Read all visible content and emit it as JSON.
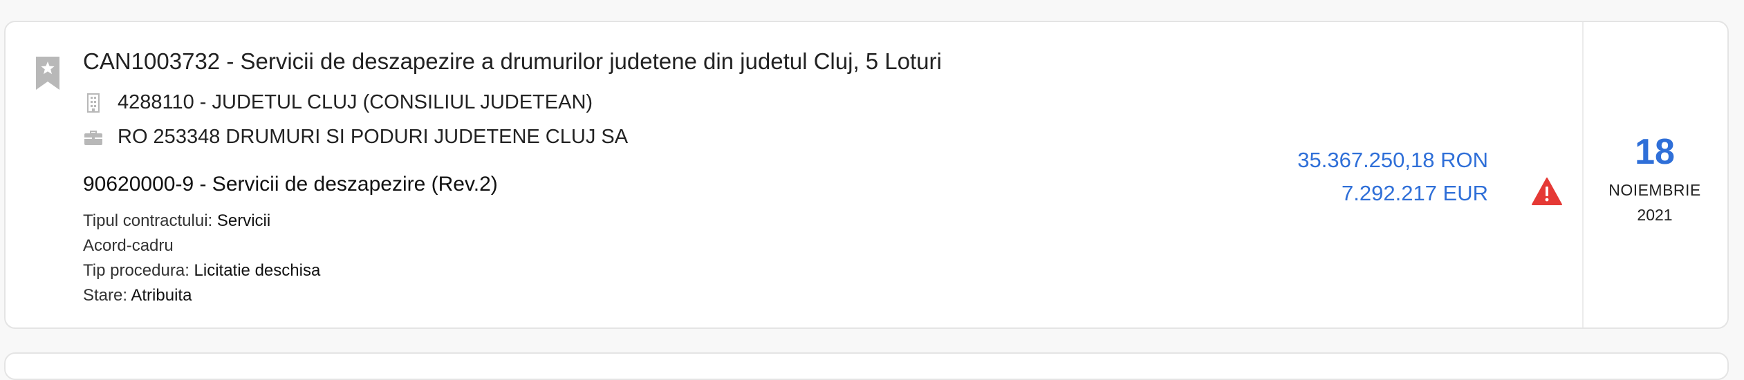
{
  "tender": {
    "title": "CAN1003732 - Servicii de deszapezire a drumurilor judetene din judetul Cluj, 5 Loturi",
    "authority": "4288110 - JUDETUL CLUJ (CONSILIUL JUDETEAN)",
    "supplier": "RO 253348 DRUMURI SI PODURI JUDETENE CLUJ SA",
    "cpv": "90620000-9 - Servicii de deszapezire (Rev.2)",
    "contract_type_label": "Tipul contractului: ",
    "contract_type_value": "Servicii",
    "agreement": "Acord-cadru",
    "procedure_label": "Tip procedura: ",
    "procedure_value": "Licitatie deschisa",
    "status_label": "Stare: ",
    "status_value": "Atribuita",
    "amount_ron": "35.367.250,18 RON",
    "amount_eur": "7.292.217 EUR",
    "date": {
      "day": "18",
      "month": "NOIEMBRIE",
      "year": "2021"
    }
  },
  "icons": {
    "bookmark": "bookmark-star-icon",
    "authority": "building-icon",
    "supplier": "briefcase-icon",
    "warning": "warning-triangle-icon"
  },
  "colors": {
    "accent": "#2f6fd8",
    "warning": "#e53935",
    "icon_gray": "#b8b8b8"
  }
}
